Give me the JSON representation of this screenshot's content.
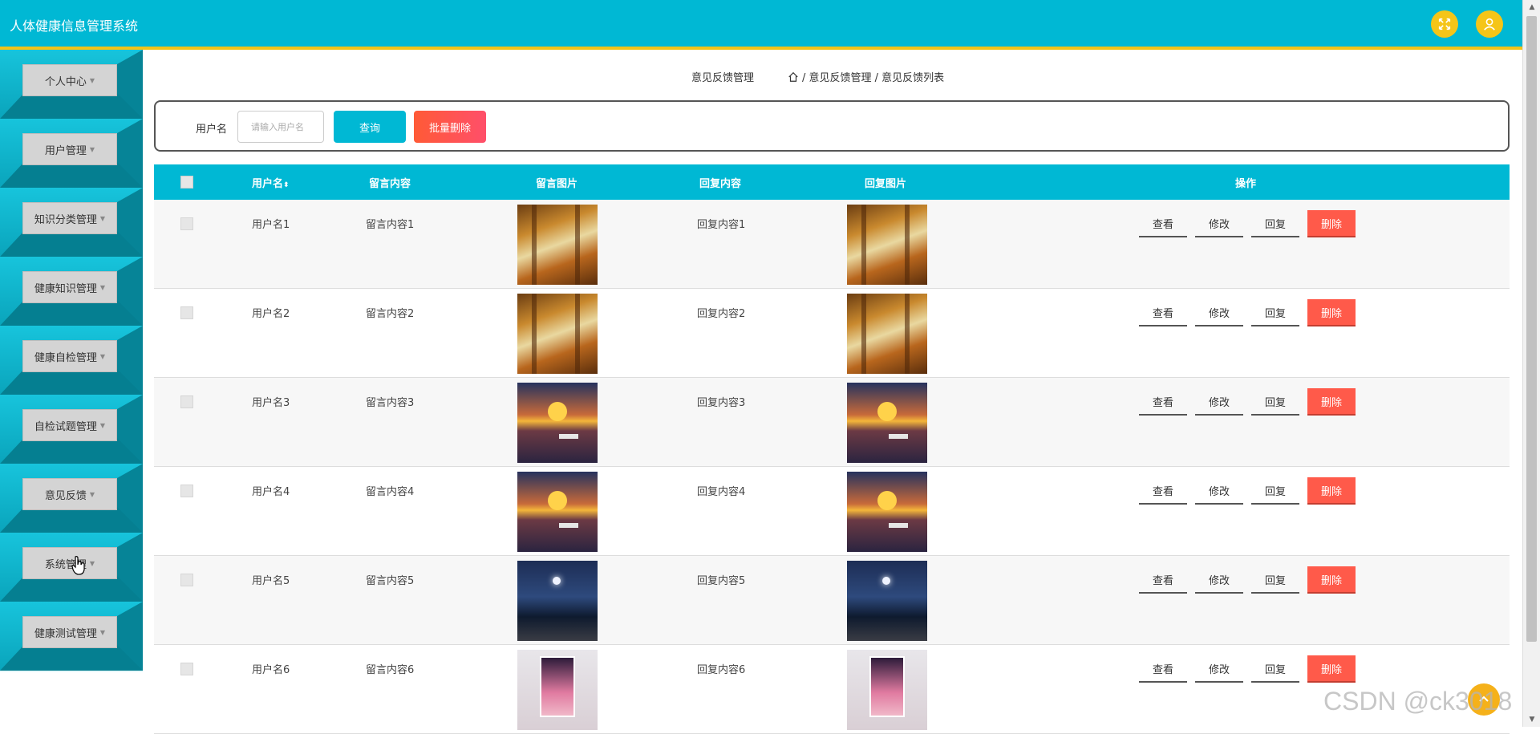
{
  "header": {
    "title": "人体健康信息管理系统",
    "accent": "#00b8d4",
    "underline": "#f0c419"
  },
  "sidebar": {
    "items": [
      {
        "label": "个人中心"
      },
      {
        "label": "用户管理"
      },
      {
        "label": "知识分类管理"
      },
      {
        "label": "健康知识管理"
      },
      {
        "label": "健康自检管理"
      },
      {
        "label": "自检试题管理"
      },
      {
        "label": "意见反馈"
      },
      {
        "label": "系统管理"
      },
      {
        "label": "健康测试管理"
      }
    ]
  },
  "breadcrumb": {
    "title": "意见反馈管理",
    "path": "/ 意见反馈管理 / 意见反馈列表"
  },
  "search": {
    "label": "用户名",
    "placeholder": "请输入用户名",
    "query_label": "查询",
    "batch_delete_label": "批量删除"
  },
  "table": {
    "headers": {
      "username": "用户名",
      "content": "留言内容",
      "image": "留言图片",
      "reply": "回复内容",
      "reply_image": "回复图片",
      "actions": "操作"
    },
    "actions": {
      "view": "查看",
      "edit": "修改",
      "reply": "回复",
      "delete": "删除"
    },
    "rows": [
      {
        "username": "用户名1",
        "content": "留言内容1",
        "reply": "回复内容1",
        "image": "forest"
      },
      {
        "username": "用户名2",
        "content": "留言内容2",
        "reply": "回复内容2",
        "image": "forest"
      },
      {
        "username": "用户名3",
        "content": "留言内容3",
        "reply": "回复内容3",
        "image": "sunset"
      },
      {
        "username": "用户名4",
        "content": "留言内容4",
        "reply": "回复内容4",
        "image": "sunset"
      },
      {
        "username": "用户名5",
        "content": "留言内容5",
        "reply": "回复内容5",
        "image": "night"
      },
      {
        "username": "用户名6",
        "content": "留言内容6",
        "reply": "回复内容6",
        "image": "pink"
      }
    ]
  },
  "watermark": "CSDN @ck3018"
}
